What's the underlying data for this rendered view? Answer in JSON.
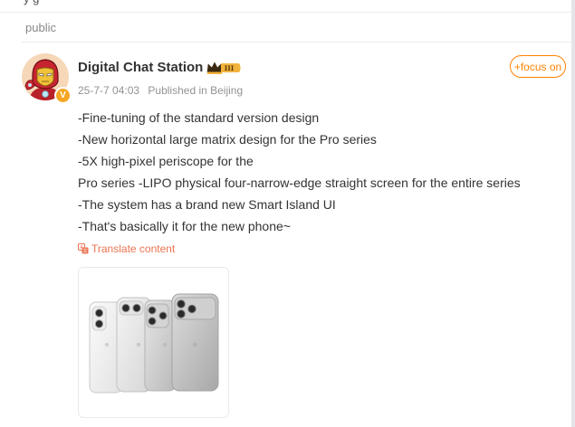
{
  "header": {
    "top_fragment": "y                                    g",
    "visibility": "public"
  },
  "post": {
    "author": {
      "name": "Digital Chat Station",
      "verified_badge": "V",
      "avatar_icon": "iron-man-avatar",
      "level_badge_icon": "crown-level-badge"
    },
    "date": "25-7-7 04:03",
    "location": "Published in Beijing",
    "follow_label": "+focus on",
    "lines": [
      "-Fine-tuning of the standard version design",
      "-New horizontal large matrix design for the Pro series",
      "-5X high-pixel periscope for the",
      "Pro series -LIPO physical four-narrow-edge straight screen for the entire series",
      "-The system has a brand new Smart Island UI",
      "-That's basically it for the new phone~"
    ],
    "translate_label": "Translate content",
    "image_description_icon": "phone-lineup-image"
  },
  "colors": {
    "accent": "#ff8200",
    "translate": "#eb7350",
    "text": "#333333",
    "meta": "#939393",
    "verified": "#f5a623"
  }
}
